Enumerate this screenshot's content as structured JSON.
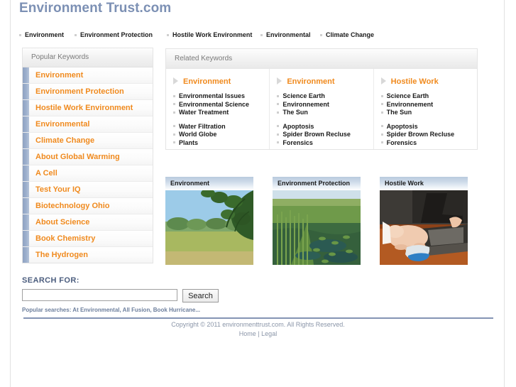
{
  "site": {
    "title": "Environment Trust.com"
  },
  "topnav": {
    "items": [
      {
        "label": "Environment"
      },
      {
        "label": "Environment Protection"
      },
      {
        "label": "Hostile Work Environment"
      },
      {
        "label": "Environmental"
      },
      {
        "label": "Climate Change"
      }
    ]
  },
  "sidebar": {
    "header": "Popular Keywords",
    "items": [
      {
        "label": "Environment"
      },
      {
        "label": "Environment Protection"
      },
      {
        "label": "Hostile Work Environment"
      },
      {
        "label": "Environmental"
      },
      {
        "label": "Climate Change"
      },
      {
        "label": "About Global Warming"
      },
      {
        "label": "A Cell"
      },
      {
        "label": "Test Your IQ"
      },
      {
        "label": "Biotechnology Ohio"
      },
      {
        "label": "About Science"
      },
      {
        "label": "Book Chemistry"
      },
      {
        "label": "The Hydrogen"
      }
    ]
  },
  "related": {
    "header": "Related Keywords",
    "columns": [
      {
        "title": "Environment",
        "group1": [
          "Environmental Issues",
          "Environmental Science",
          "Water Treatment"
        ],
        "group2": [
          "Water Filtration",
          "World Globe",
          "Plants"
        ]
      },
      {
        "title": "Environment",
        "group1": [
          "Science Earth",
          "Environnement",
          "The Sun"
        ],
        "group2": [
          "Apoptosis",
          "Spider Brown Recluse",
          "Forensics"
        ]
      },
      {
        "title": "Hostile Work",
        "group1": [
          "Science Earth",
          "Environnement",
          "The Sun"
        ],
        "group2": [
          "Apoptosis",
          "Spider Brown Recluse",
          "Forensics"
        ]
      }
    ]
  },
  "thumbnails": [
    {
      "caption": "Environment",
      "alt": "green field with tree branches under blue sky"
    },
    {
      "caption": "Environment Protection",
      "alt": "wetland marsh with reeds and water"
    },
    {
      "caption": "Hostile Work",
      "alt": "hand on computer mouse next to laptop"
    }
  ],
  "search": {
    "label": "SEARCH FOR:",
    "value": "",
    "placeholder": "",
    "button_label": "Search",
    "popular_searches": "Popular searches: At Environmental, All Fusion, Book Hurricane..."
  },
  "footer": {
    "copyright": "Copyright © 2011 environmenttrust.com. All Rights Reserved.",
    "home_label": "Home",
    "separator": "|",
    "legal_label": "Legal"
  },
  "colors": {
    "title_blue": "#7c90b4",
    "keyword_orange": "#f08a1e",
    "accent_bar": "#9db0cd",
    "footer_rule": "#8494b4",
    "search_label": "#4b5d7e"
  }
}
